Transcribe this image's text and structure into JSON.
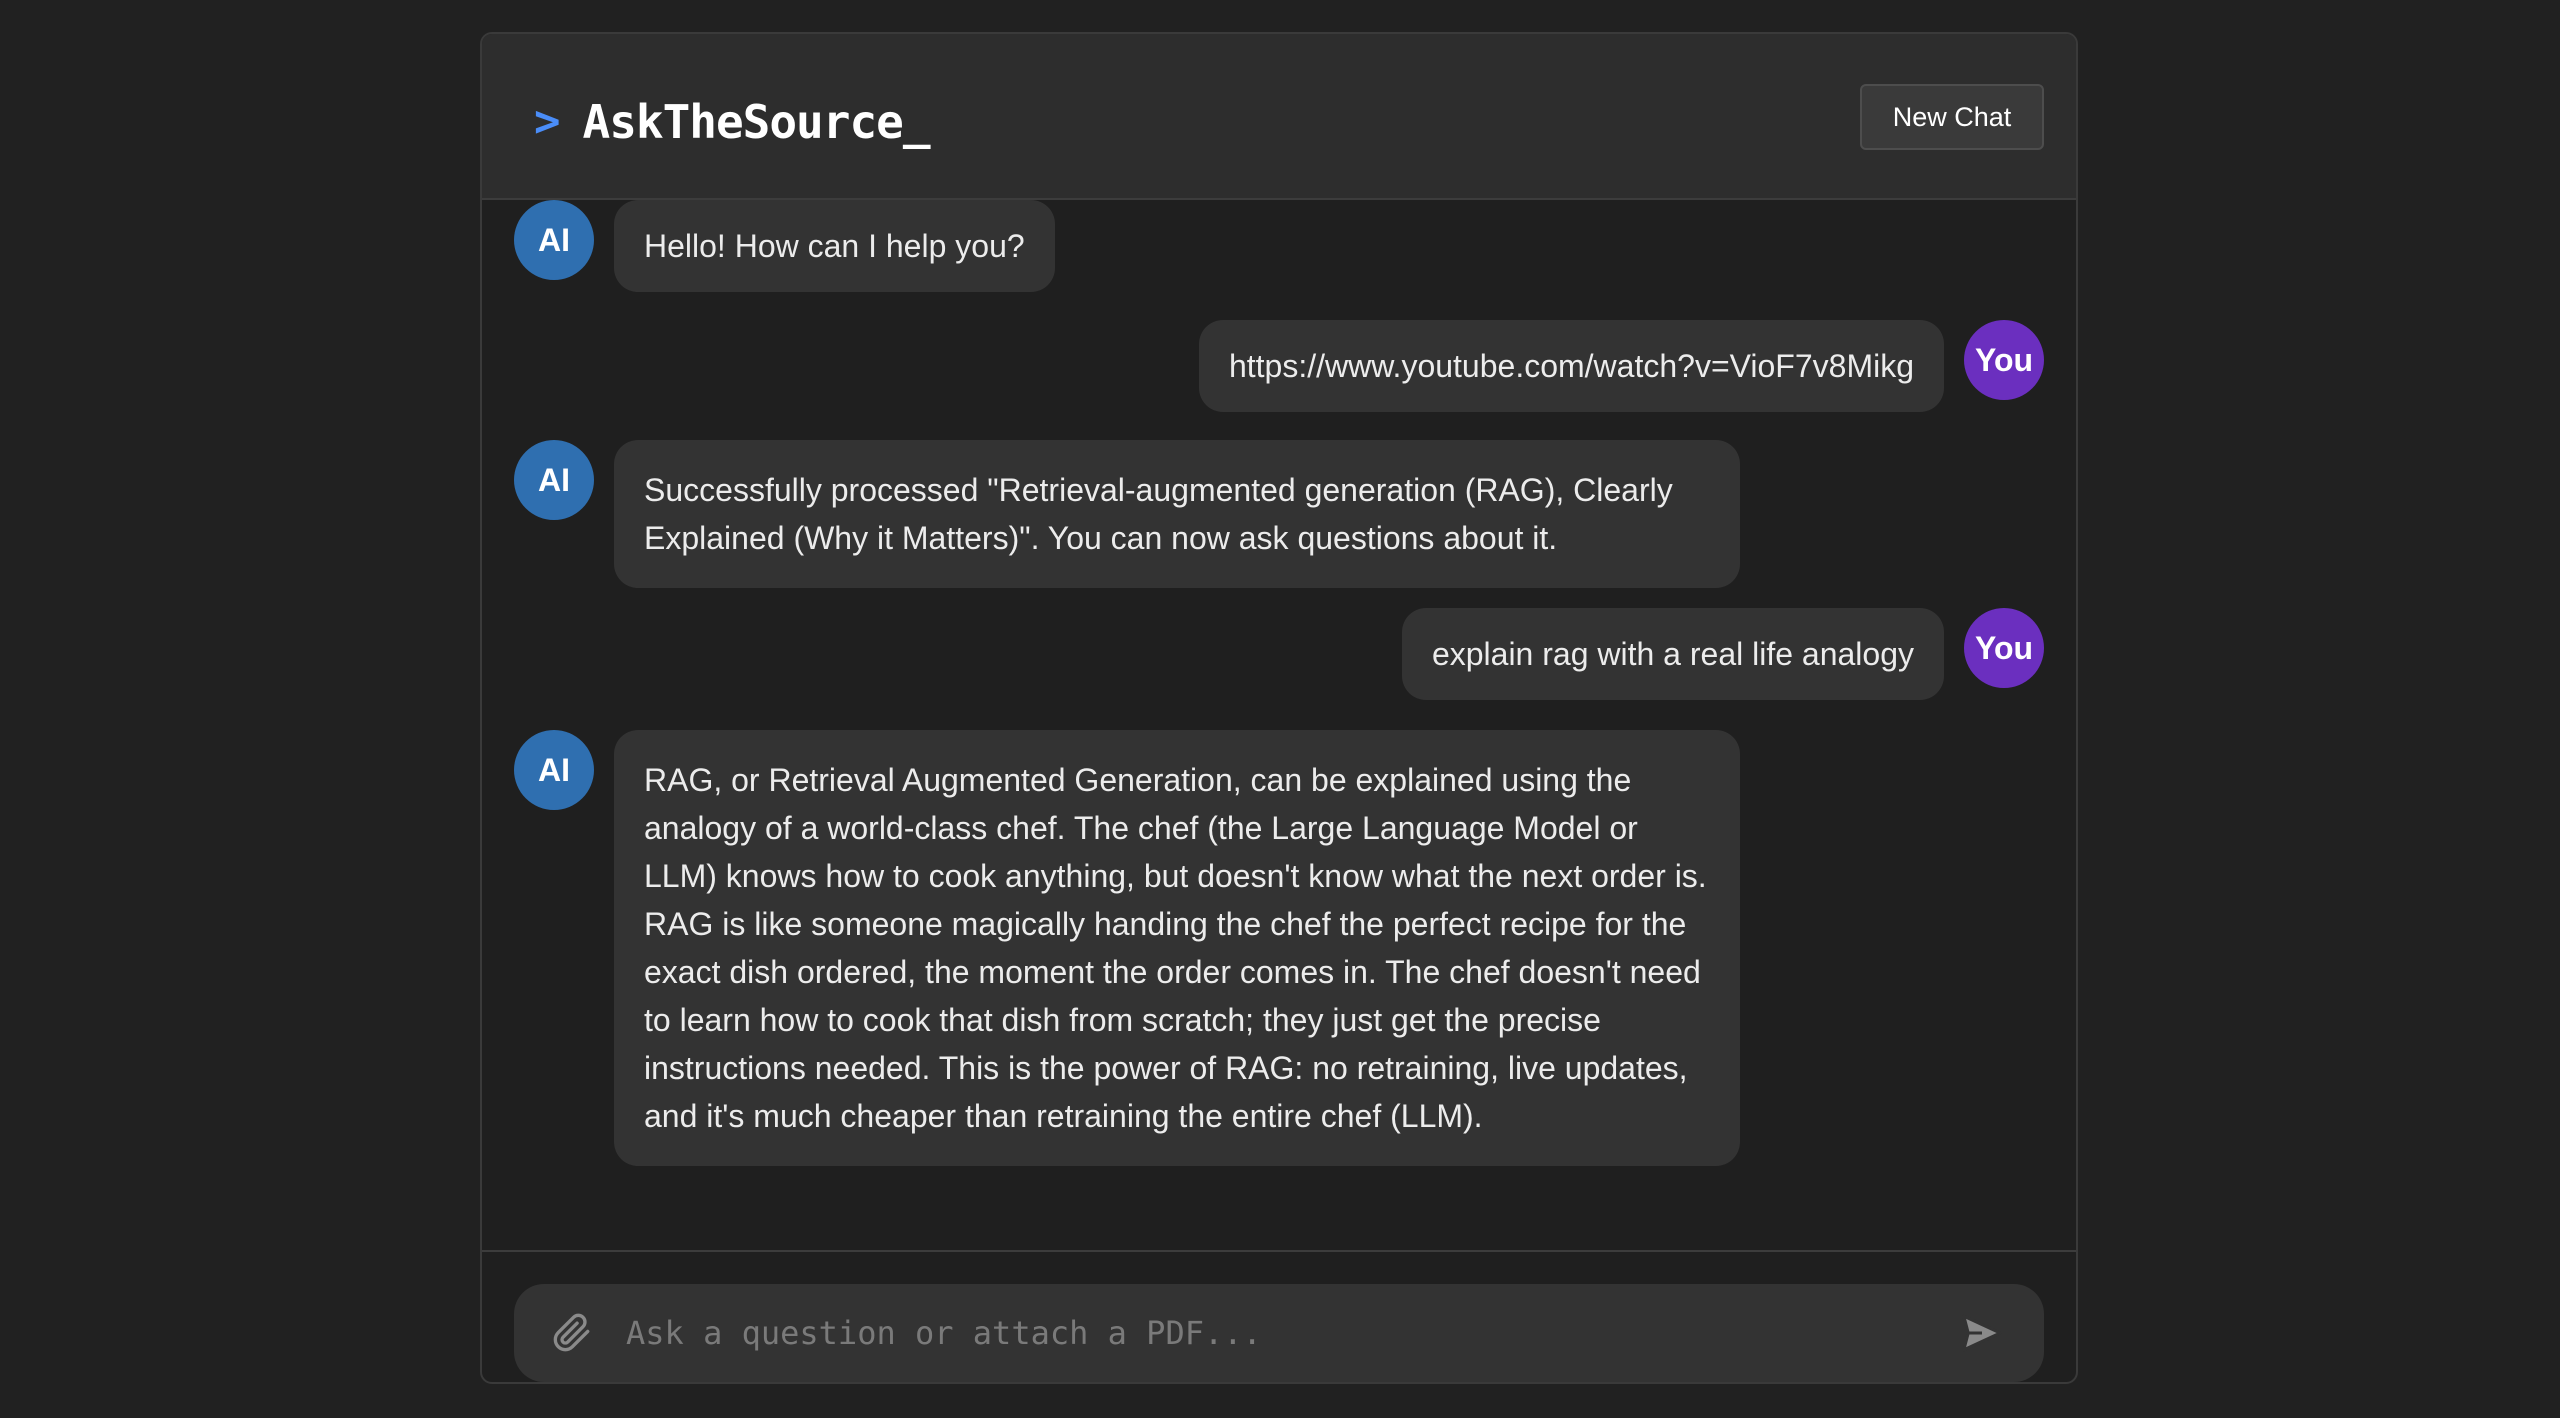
{
  "header": {
    "prompt_symbol": ">",
    "app_title": "AskTheSource",
    "cursor": "_",
    "new_chat_label": "New Chat"
  },
  "messages": [
    {
      "role": "ai",
      "avatar": "AI",
      "text": "Hello! How can I help you?"
    },
    {
      "role": "user",
      "avatar": "You",
      "text": "https://www.youtube.com/watch?v=VioF7v8Mikg"
    },
    {
      "role": "ai",
      "avatar": "AI",
      "text": "Successfully processed \"Retrieval-augmented generation (RAG), Clearly Explained (Why it Matters)\". You can now ask questions about it."
    },
    {
      "role": "user",
      "avatar": "You",
      "text": "explain rag with a real life analogy"
    },
    {
      "role": "ai",
      "avatar": "AI",
      "text": "RAG, or Retrieval Augmented Generation, can be explained using the analogy of a world-class chef.  The chef (the Large Language Model or LLM) knows how to cook anything, but doesn't know what the next order is.  RAG is like someone magically handing the chef the perfect recipe for the exact dish ordered, the moment the order comes in.  The chef doesn't need to learn how to cook that dish from scratch; they just get the precise instructions needed.  This is the power of RAG: no retraining, live updates, and it's much cheaper than retraining the entire chef (LLM)."
    }
  ],
  "composer": {
    "placeholder": "Ask a question or attach a PDF...",
    "value": "",
    "attach_icon": "paperclip-icon",
    "send_icon": "send-icon"
  },
  "colors": {
    "background": "#212121",
    "accent": "#4a8df8",
    "ai_avatar": "#2f6fb0",
    "user_avatar": "#6b2fbf",
    "bubble": "#333333"
  }
}
